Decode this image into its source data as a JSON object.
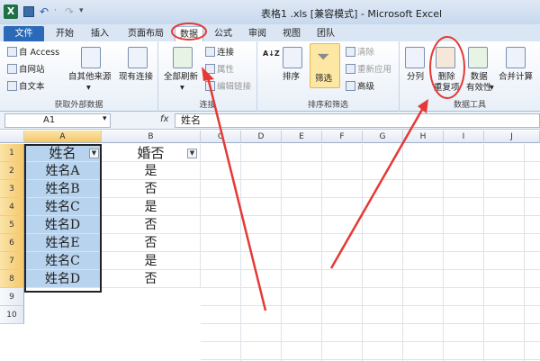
{
  "window": {
    "title": "表格1 .xls [兼容模式] - Microsoft Excel",
    "logo_letter": "X",
    "qat": {
      "undo": "↶",
      "separator": "·",
      "redo": "↷",
      "dropdown": "▾"
    }
  },
  "tabs": [
    {
      "label": "文件"
    },
    {
      "label": "开始"
    },
    {
      "label": "插入"
    },
    {
      "label": "页面布局"
    },
    {
      "label": "数据",
      "active": true
    },
    {
      "label": "公式"
    },
    {
      "label": "审阅"
    },
    {
      "label": "视图"
    },
    {
      "label": "团队"
    }
  ],
  "ribbon": {
    "groups": [
      {
        "label": "获取外部数据",
        "items": [
          "自 Access",
          "自网站",
          "自文本",
          "自其他来源",
          "现有连接"
        ]
      },
      {
        "label": "连接",
        "items": [
          "全部刷新",
          "连接",
          "属性",
          "编辑链接"
        ]
      },
      {
        "label": "排序和筛选",
        "items": [
          "排序",
          "筛选",
          "清除",
          "重新应用",
          "高级"
        ]
      },
      {
        "label": "数据工具",
        "items": [
          "分列",
          "删除\n重复项",
          "数据\n有效性",
          "合并计算"
        ]
      }
    ],
    "dropdown_marker": "▾",
    "sort_az_icon": "A↓Z"
  },
  "formula_bar": {
    "name_box": "A1",
    "name_box_dropdown": "▾",
    "fx_label": "fx",
    "content": "姓名"
  },
  "sheet": {
    "columns": [
      "A",
      "B",
      "C",
      "D",
      "E",
      "F",
      "G",
      "H",
      "I",
      "J"
    ],
    "rows": [
      "1",
      "2",
      "3",
      "4",
      "5",
      "6",
      "7",
      "8",
      "9",
      "10"
    ],
    "filter_glyph": "▼",
    "header_row": {
      "a": "姓名",
      "b": "婚否"
    },
    "data": [
      {
        "a": "姓名A",
        "b": "是"
      },
      {
        "a": "姓名B",
        "b": "否"
      },
      {
        "a": "姓名C",
        "b": "是"
      },
      {
        "a": "姓名D",
        "b": "否"
      },
      {
        "a": "姓名E",
        "b": "否"
      },
      {
        "a": "姓名C",
        "b": "是"
      },
      {
        "a": "姓名D",
        "b": "否"
      }
    ]
  },
  "annotation_color": "#e53935",
  "accent": "#2a6ab8"
}
